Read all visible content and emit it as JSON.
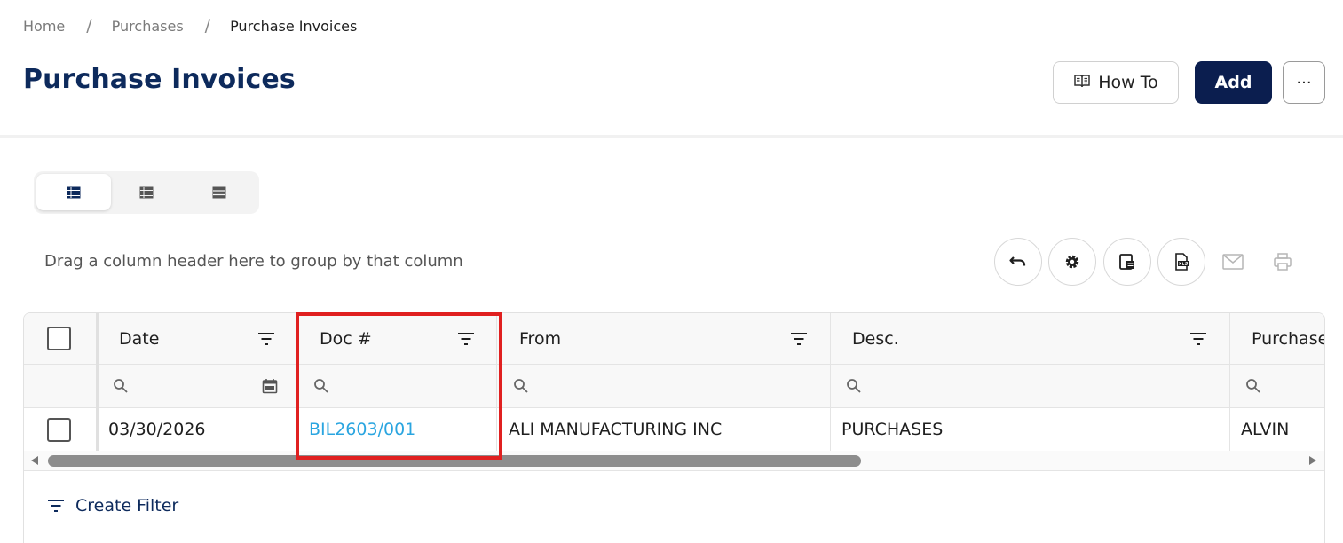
{
  "breadcrumb": {
    "items": [
      "Home",
      "Purchases",
      "Purchase Invoices"
    ],
    "separator": "/"
  },
  "page": {
    "title": "Purchase Invoices"
  },
  "header_buttons": {
    "how_to": "How To",
    "add": "Add",
    "more": "···"
  },
  "toolbar": {
    "group_hint": "Drag a column header here to group by that column"
  },
  "grid": {
    "columns": [
      "Date",
      "Doc #",
      "From",
      "Desc.",
      "Purchase"
    ],
    "rows": [
      {
        "date": "03/30/2026",
        "doc": "BIL2603/001",
        "from": "ALI MANUFACTURING INC",
        "desc": "PURCHASES",
        "purchaser": "ALVIN"
      }
    ]
  },
  "footer": {
    "create_filter": "Create Filter"
  },
  "colors": {
    "title": "#0d2a5c",
    "add_button": "#0b1e4f",
    "link": "#2aa5e0",
    "highlight": "#e02020"
  }
}
